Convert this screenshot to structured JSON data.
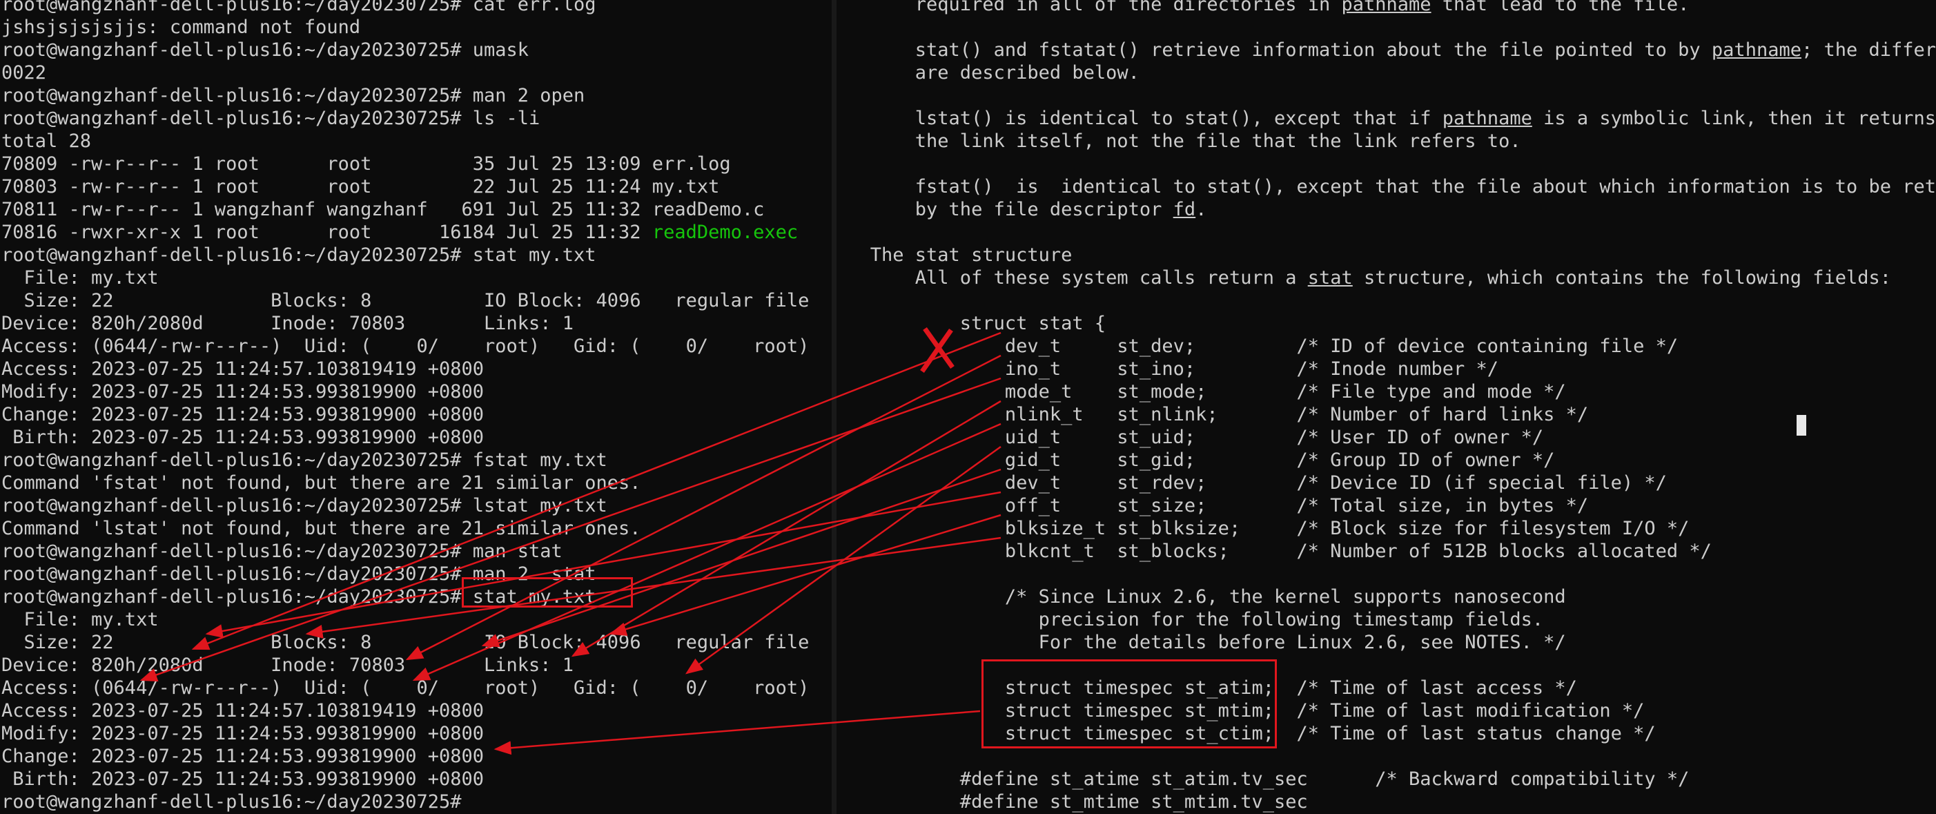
{
  "terminal": {
    "lines": [
      "root@wangzhanf-dell-plus16:~/day20230725# cat err.log",
      "jshsjsjsjsjjs: command not found",
      "root@wangzhanf-dell-plus16:~/day20230725# umask",
      "0022",
      "root@wangzhanf-dell-plus16:~/day20230725# man 2 open",
      "root@wangzhanf-dell-plus16:~/day20230725# ls -li",
      "total 28",
      "70809 -rw-r--r-- 1 root      root         35 Jul 25 13:09 err.log",
      "70803 -rw-r--r-- 1 root      root         22 Jul 25 11:24 my.txt",
      "70811 -rw-r--r-- 1 wangzhanf wangzhanf   691 Jul 25 11:32 readDemo.c",
      "70816 -rwxr-xr-x 1 root      root      16184 Jul 25 11:32 ",
      "root@wangzhanf-dell-plus16:~/day20230725# stat my.txt",
      "  File: my.txt",
      "  Size: 22         \tBlocks: 8          IO Block: 4096   regular file",
      "Device: 820h/2080d\tInode: 70803       Links: 1",
      "Access: (0644/-rw-r--r--)  Uid: (    0/    root)   Gid: (    0/    root)",
      "Access: 2023-07-25 11:24:57.103819419 +0800",
      "Modify: 2023-07-25 11:24:53.993819900 +0800",
      "Change: 2023-07-25 11:24:53.993819900 +0800",
      " Birth: 2023-07-25 11:24:53.993819900 +0800",
      "root@wangzhanf-dell-plus16:~/day20230725# fstat my.txt",
      "Command 'fstat' not found, but there are 21 similar ones.",
      "root@wangzhanf-dell-plus16:~/day20230725# lstat my.txt",
      "Command 'lstat' not found, but there are 21 similar ones.",
      "root@wangzhanf-dell-plus16:~/day20230725# man stat",
      "root@wangzhanf-dell-plus16:~/day20230725# man 2  stat",
      "root@wangzhanf-dell-plus16:~/day20230725# stat my.txt",
      "  File: my.txt",
      "  Size: 22         \tBlocks: 8          IO Block: 4096   regular file",
      "Device: 820h/2080d\tInode: 70803       Links: 1",
      "Access: (0644/-rw-r--r--)  Uid: (    0/    root)   Gid: (    0/    root)",
      "Access: 2023-07-25 11:24:57.103819419 +0800",
      "Modify: 2023-07-25 11:24:53.993819900 +0800",
      "Change: 2023-07-25 11:24:53.993819900 +0800",
      " Birth: 2023-07-25 11:24:53.993819900 +0800",
      "root@wangzhanf-dell-plus16:~/day20230725# "
    ],
    "exec_file": "readDemo.exec",
    "exec_color": "#16c60c"
  },
  "manpage": {
    "rows": [
      {
        "i": 0,
        "segs": [
          {
            "t": "       required in all of the directories in "
          },
          {
            "t": "pathname",
            "u": true
          },
          {
            "t": " that lead to the file."
          }
        ]
      },
      {
        "i": 2,
        "segs": [
          {
            "t": "       stat() and fstatat() retrieve information about the file pointed to by "
          },
          {
            "t": "pathname",
            "u": true
          },
          {
            "t": "; the differen"
          }
        ]
      },
      {
        "i": 3,
        "segs": [
          {
            "t": "       are described below."
          }
        ]
      },
      {
        "i": 5,
        "segs": [
          {
            "t": "       lstat() is identical to stat(), except that if "
          },
          {
            "t": "pathname",
            "u": true
          },
          {
            "t": " is a symbolic link, then it returns i"
          }
        ]
      },
      {
        "i": 6,
        "segs": [
          {
            "t": "       the link itself, not the file that the link refers to."
          }
        ]
      },
      {
        "i": 8,
        "segs": [
          {
            "t": "       fstat()  is  identical to stat(), except that the file about which information is to be retri"
          }
        ]
      },
      {
        "i": 9,
        "segs": [
          {
            "t": "       by the file descriptor "
          },
          {
            "t": "fd",
            "u": true
          },
          {
            "t": "."
          }
        ]
      },
      {
        "i": 11,
        "segs": [
          {
            "t": "   The stat structure"
          }
        ]
      },
      {
        "i": 12,
        "segs": [
          {
            "t": "       All of these system calls return a "
          },
          {
            "t": "stat",
            "u": true
          },
          {
            "t": " structure, which contains the following fields:"
          }
        ]
      },
      {
        "i": 14,
        "segs": [
          {
            "t": "           struct stat {"
          }
        ]
      },
      {
        "i": 15,
        "segs": [
          {
            "t": "               dev_t     st_dev;         /* ID of device containing file */"
          }
        ]
      },
      {
        "i": 16,
        "segs": [
          {
            "t": "               ino_t     st_ino;         /* Inode number */"
          }
        ]
      },
      {
        "i": 17,
        "segs": [
          {
            "t": "               mode_t    st_mode;        /* File type and mode */"
          }
        ]
      },
      {
        "i": 18,
        "segs": [
          {
            "t": "               nlink_t   st_nlink;       /* Number of hard links */"
          }
        ]
      },
      {
        "i": 19,
        "segs": [
          {
            "t": "               uid_t     st_uid;         /* User ID of owner */"
          }
        ]
      },
      {
        "i": 20,
        "segs": [
          {
            "t": "               gid_t     st_gid;         /* Group ID of owner */"
          }
        ]
      },
      {
        "i": 21,
        "segs": [
          {
            "t": "               dev_t     st_rdev;        /* Device ID (if special file) */"
          }
        ]
      },
      {
        "i": 22,
        "segs": [
          {
            "t": "               off_t     st_size;        /* Total size, in bytes */"
          }
        ]
      },
      {
        "i": 23,
        "segs": [
          {
            "t": "               blksize_t st_blksize;     /* Block size for filesystem I/O */"
          }
        ]
      },
      {
        "i": 24,
        "segs": [
          {
            "t": "               blkcnt_t  st_blocks;      /* Number of 512B blocks allocated */"
          }
        ]
      },
      {
        "i": 26,
        "segs": [
          {
            "t": "               /* Since Linux 2.6, the kernel supports nanosecond"
          }
        ]
      },
      {
        "i": 27,
        "segs": [
          {
            "t": "                  precision for the following timestamp fields."
          }
        ]
      },
      {
        "i": 28,
        "segs": [
          {
            "t": "                  For the details before Linux 2.6, see NOTES. */"
          }
        ]
      },
      {
        "i": 30,
        "segs": [
          {
            "t": "               struct timespec st_atim;  /* Time of last access */"
          }
        ]
      },
      {
        "i": 31,
        "segs": [
          {
            "t": "               struct timespec st_mtim;  /* Time of last modification */"
          }
        ]
      },
      {
        "i": 32,
        "segs": [
          {
            "t": "               struct timespec st_ctim;  /* Time of last status change */"
          }
        ]
      },
      {
        "i": 34,
        "segs": [
          {
            "t": "           #define st_atime st_atim.tv_sec      /* Backward compatibility */"
          }
        ]
      },
      {
        "i": 35,
        "segs": [
          {
            "t": "           #define st_mtime st_mtim.tv_sec"
          }
        ]
      },
      {
        "i": 36,
        "segs": [
          {
            "t": "           #define st_ctime st_ctim.tv_sec"
          }
        ]
      }
    ]
  },
  "annotation": {
    "color": "#e0161d"
  }
}
